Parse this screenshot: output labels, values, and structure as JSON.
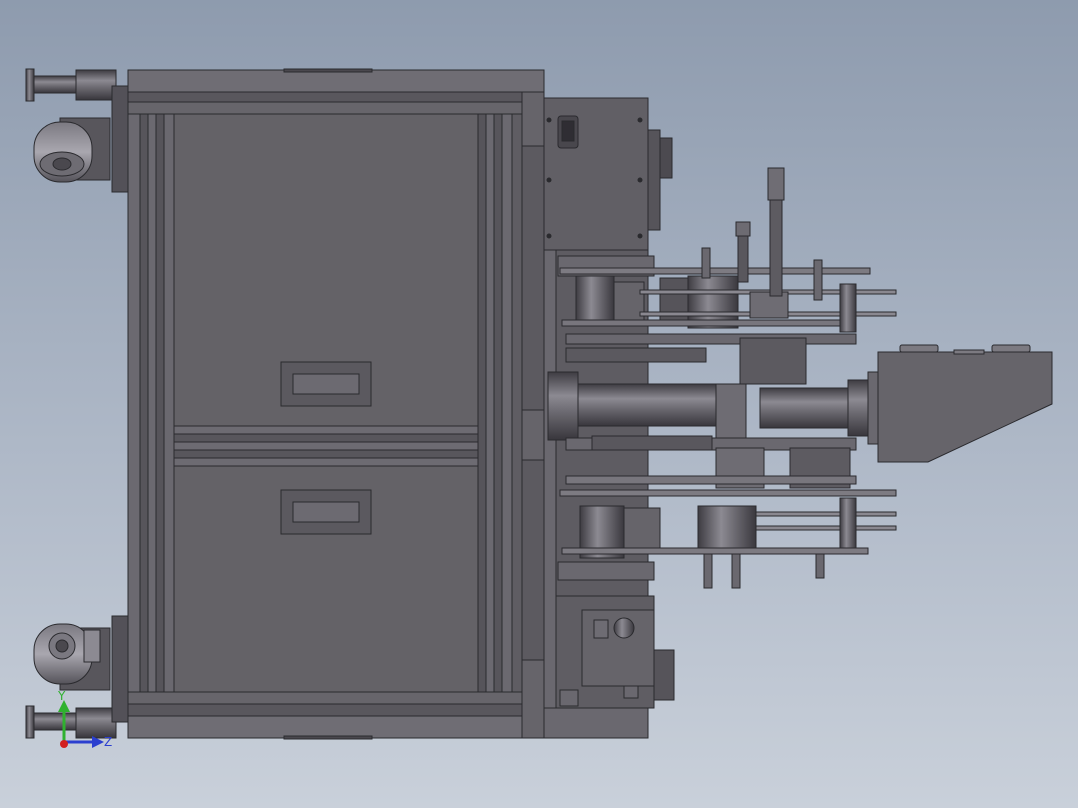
{
  "viewport": {
    "background_top": "#8e9bae",
    "background_bottom": "#c9d0da"
  },
  "model": {
    "body_color": "#5f5d63",
    "edge_color": "#2a2a2e",
    "highlight_color": "#8a8890"
  },
  "triad": {
    "y_label": "Y",
    "z_label": "Z",
    "y_color": "#2fb12f",
    "z_color": "#2b3fcf",
    "origin_color": "#d22020"
  }
}
